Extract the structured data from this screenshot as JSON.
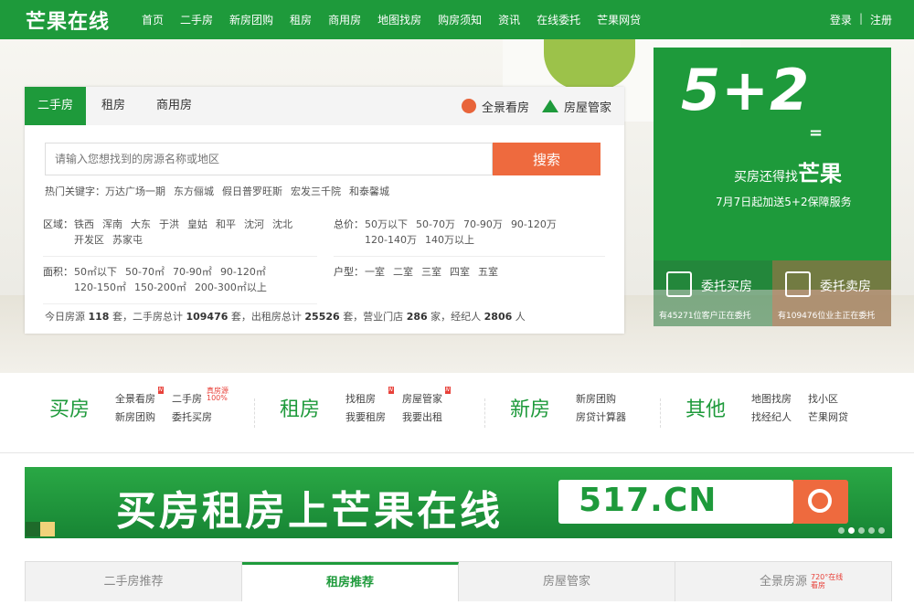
{
  "header": {
    "logo": "芒果在线",
    "nav": [
      "首页",
      "二手房",
      "新房团购",
      "租房",
      "商用房",
      "地图找房",
      "购房须知",
      "资讯",
      "在线委托",
      "芒果网贷"
    ],
    "login": "登录",
    "divider": "|",
    "register": "注册"
  },
  "search_panel": {
    "tabs": [
      "二手房",
      "租房",
      "商用房"
    ],
    "active_tab": "二手房",
    "right_links": [
      "全景看房",
      "房屋管家"
    ],
    "input_placeholder": "请输入您想找到的房源名称或地区",
    "button": "搜索",
    "hot_label": "热门关键字：",
    "hot_keywords": [
      "万达广场一期",
      "东方俪城",
      "假日普罗旺斯",
      "宏发三千院",
      "和泰馨城"
    ],
    "filters": {
      "area": {
        "label": "区域：",
        "items": [
          "铁西",
          "浑南",
          "大东",
          "于洪",
          "皇姑",
          "和平",
          "沈河",
          "沈北",
          "开发区",
          "苏家屯"
        ]
      },
      "price": {
        "label": "总价：",
        "items": [
          "50万以下",
          "50-70万",
          "70-90万",
          "90-120万",
          "120-140万",
          "140万以上"
        ]
      },
      "size": {
        "label": "面积：",
        "items": [
          "50㎡以下",
          "50-70㎡",
          "70-90㎡",
          "90-120㎡",
          "120-150㎡",
          "150-200㎡",
          "200-300㎡以上"
        ]
      },
      "rooms": {
        "label": "户型：",
        "items": [
          "一室",
          "二室",
          "三室",
          "四室",
          "五室"
        ]
      }
    },
    "stats": {
      "p1": "今日房源",
      "today": "118",
      "p2": "套，二手房总计",
      "secondhand": "109476",
      "p3": "套，出租房总计",
      "rental": "25526",
      "p4": "套，营业门店",
      "stores": "286",
      "p5": "家，经纪人",
      "agents": "2806",
      "p6": "人"
    }
  },
  "promo": {
    "big": "5+2",
    "eq": "=",
    "slogan_pre": "买房还得找",
    "slogan_brand": "芒果",
    "slogan2": "7月7日起加送5+2保障服务",
    "buy_title": "委托买房",
    "buy_sub": "有45271位客户正在委托",
    "sell_title": "委托卖房",
    "sell_sub": "有109476位业主正在委托"
  },
  "quick": {
    "buy": {
      "title": "买房",
      "links": [
        "全景看房",
        "二手房",
        "新房团购",
        "委托买房"
      ],
      "tag_new": "N",
      "tag_hot": "真房源100%"
    },
    "rent": {
      "title": "租房",
      "links": [
        "找租房",
        "房屋管家",
        "我要租房",
        "我要出租"
      ],
      "tag_new": "N"
    },
    "newhouse": {
      "title": "新房",
      "links": [
        "新房团购",
        "房贷计算器"
      ]
    },
    "other": {
      "title": "其他",
      "links": [
        "地图找房",
        "找小区",
        "找经纪人",
        "芒果网贷"
      ]
    }
  },
  "banner": {
    "text": "买房租房上芒果在线",
    "url": "517.CN"
  },
  "rec_tabs": [
    "二手房推荐",
    "租房推荐",
    "房屋管家",
    "全景房源"
  ],
  "rec_active": "租房推荐",
  "rec_sup": "720°在线看房",
  "colors": {
    "brand": "#1e9a3b",
    "accent": "#ee6a3e"
  }
}
